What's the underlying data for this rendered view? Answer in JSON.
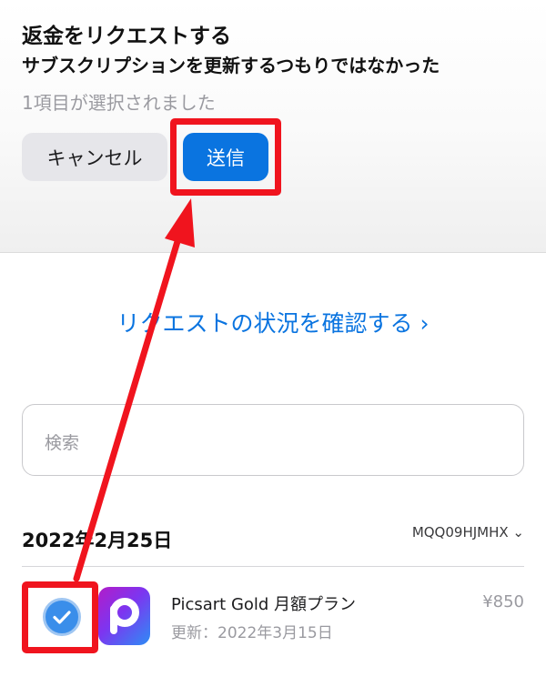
{
  "header": {
    "title": "返金をリクエストする",
    "reason": "サブスクリプションを更新するつもりではなかった",
    "selection_count": "1項目が選択されました"
  },
  "actions": {
    "cancel_label": "キャンセル",
    "send_label": "送信"
  },
  "status_link": "リクエストの状況を確認する ›",
  "search": {
    "placeholder": "検索"
  },
  "order": {
    "date": "2022年2月25日",
    "order_id": "MQQ09HJMHX ⌄",
    "items": [
      {
        "name": "Picsart Gold 月額プラン",
        "renewal": "更新：2022年3月15日",
        "price": "¥850",
        "selected": true,
        "icon": "picsart-app-icon"
      }
    ]
  },
  "annotations": {
    "highlight_color": "#f0141e",
    "arrow": "checkbox-to-send-button"
  },
  "colors": {
    "accent": "#0a74e0",
    "secondary_text": "#9a9aa0"
  }
}
